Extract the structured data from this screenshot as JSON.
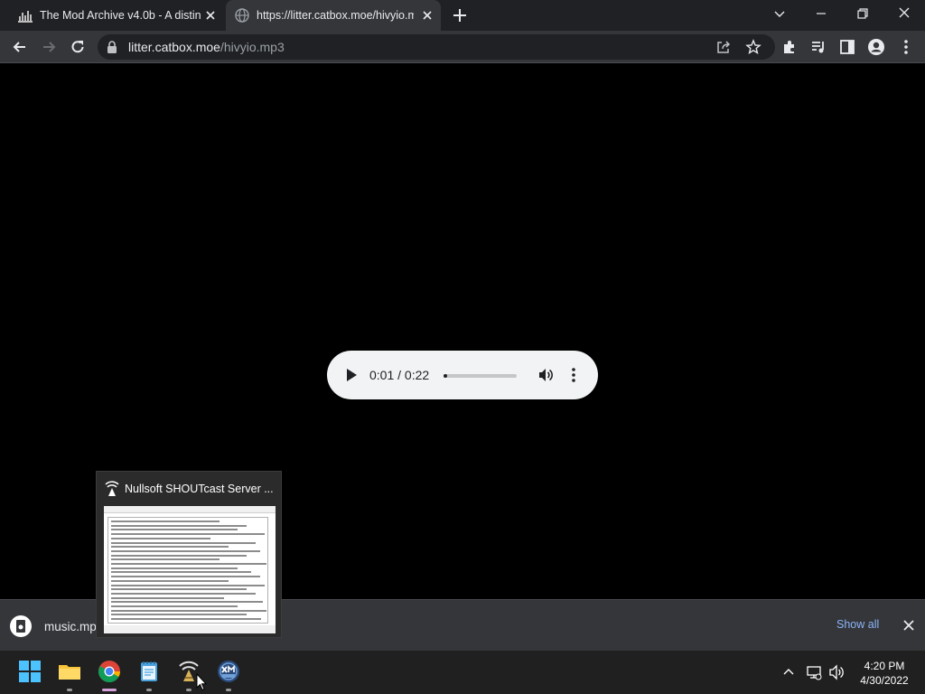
{
  "browser": {
    "tabs": [
      {
        "title": "The Mod Archive v4.0b - A distin",
        "active": false
      },
      {
        "title": "https://litter.catbox.moe/hivyio.m",
        "active": true
      }
    ],
    "address": {
      "host": "litter.catbox.moe",
      "path": "/hivyio.mp3"
    }
  },
  "player": {
    "time": "0:01 / 0:22",
    "progress_fraction": 0.05
  },
  "downloads": {
    "file_name": "music.mp3",
    "show_all": "Show all"
  },
  "preview": {
    "title": "Nullsoft SHOUTcast Server ..."
  },
  "taskbar": {
    "time": "4:20 PM",
    "date": "4/30/2022"
  },
  "colors": {
    "chrome_dark": "#202124",
    "chrome_toolbar": "#35363a",
    "link_blue": "#8ab4f8",
    "player_bg": "#f1f3f4",
    "taskbar": "#202020"
  }
}
